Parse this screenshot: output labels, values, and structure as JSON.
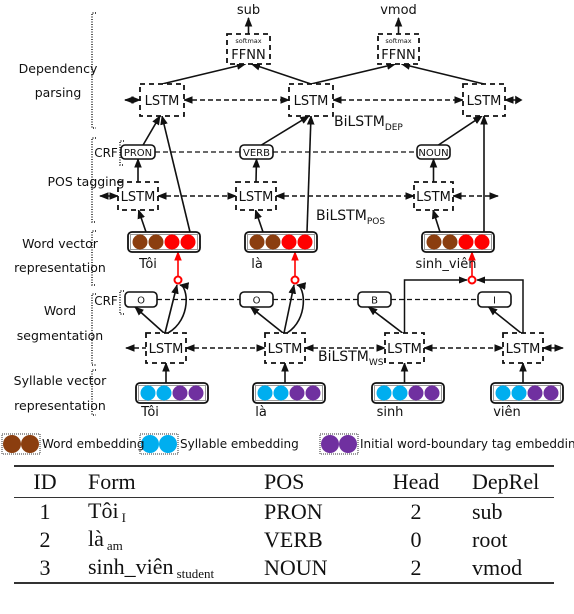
{
  "figure": {
    "section_labels": [
      {
        "id": "dep",
        "lines": [
          "Dependency",
          "parsing"
        ]
      },
      {
        "id": "pos",
        "lines": [
          "POS tagging"
        ]
      },
      {
        "id": "wordvec",
        "lines": [
          "Word vector",
          "representation"
        ]
      },
      {
        "id": "ws",
        "lines": [
          "Word",
          "segmentation"
        ]
      },
      {
        "id": "sylvec",
        "lines": [
          "Syllable vector",
          "representation"
        ]
      }
    ],
    "crf_label": "CRF",
    "lstm_label": "LSTM",
    "ffnn_label": "FFNN",
    "softmax_label": "softmax",
    "bilstm": {
      "dep": {
        "base": "BiLSTM",
        "sub": "DEP"
      },
      "pos": {
        "base": "BiLSTM",
        "sub": "POS"
      },
      "ws": {
        "base": "BiLSTM",
        "sub": "WS"
      }
    },
    "dep_outputs": [
      "sub",
      "vmod"
    ],
    "pos_tags": [
      "PRON",
      "VERB",
      "NOUN"
    ],
    "words": [
      "Tôi",
      "là",
      "sinh_viên"
    ],
    "ws_tags": [
      "O",
      "O",
      "B",
      "I"
    ],
    "syllables": [
      "Tôi",
      "là",
      "sinh",
      "viên"
    ],
    "colors": {
      "word_embedding": "#8B3E0F",
      "syllable_embedding": "#00AEEF",
      "tag_embedding": "#7030A0",
      "red_link": "#FF0000",
      "stroke": "#111111"
    },
    "legend": [
      {
        "key": "word_embedding",
        "label": "Word embedding"
      },
      {
        "key": "syllable_embedding",
        "label": "Syllable embedding"
      },
      {
        "key": "tag_embedding",
        "label": "Initial word-boundary tag embedding"
      }
    ]
  },
  "table": {
    "headers": [
      "ID",
      "Form",
      "POS",
      "Head",
      "DepRel"
    ],
    "rows": [
      {
        "id": "1",
        "form": "Tôi",
        "gloss": "I",
        "pos": "PRON",
        "head": "2",
        "deprel": "sub"
      },
      {
        "id": "2",
        "form": "là",
        "gloss": "am",
        "pos": "VERB",
        "head": "0",
        "deprel": "root"
      },
      {
        "id": "3",
        "form": "sinh_viên",
        "gloss": "student",
        "pos": "NOUN",
        "head": "2",
        "deprel": "vmod"
      }
    ]
  }
}
